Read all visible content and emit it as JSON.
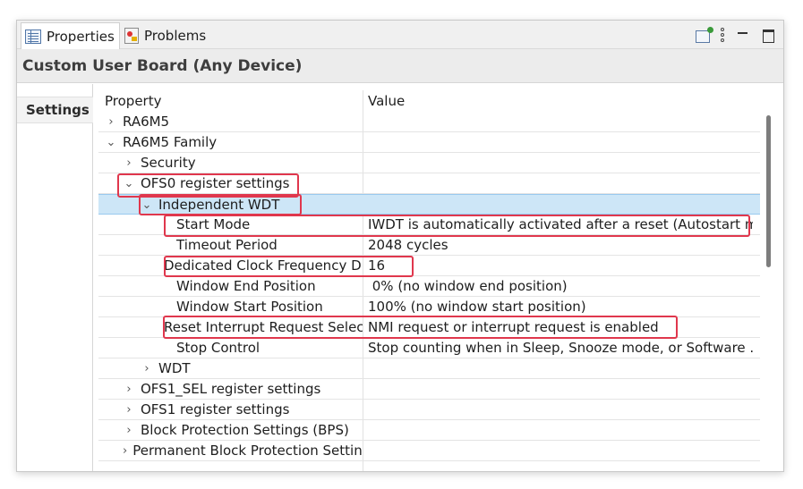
{
  "tabs": {
    "properties_label": "Properties",
    "problems_label": "Problems"
  },
  "toolbar": {
    "icons": [
      "pin-to-selection-icon",
      "view-menu-icon",
      "minimize-icon",
      "maximize-icon"
    ]
  },
  "header": {
    "title": "Custom User Board (Any Device)"
  },
  "side": {
    "settings_label": "Settings"
  },
  "table": {
    "col_property": "Property",
    "col_value": "Value",
    "rows": [
      {
        "label": "RA6M5",
        "value": "",
        "twisty": "›",
        "depth": 0
      },
      {
        "label": "RA6M5 Family",
        "value": "",
        "twisty": "⌄",
        "depth": 0
      },
      {
        "label": "Security",
        "value": "",
        "twisty": "›",
        "depth": 1
      },
      {
        "label": "OFS0 register settings",
        "value": "",
        "twisty": "⌄",
        "depth": 1
      },
      {
        "label": "Independent WDT",
        "value": "",
        "twisty": "⌄",
        "depth": 2
      },
      {
        "label": "Start Mode",
        "value": "IWDT is automatically activated after a reset (Autostart m...",
        "twisty": "",
        "depth": 3
      },
      {
        "label": "Timeout Period",
        "value": "2048 cycles",
        "twisty": "",
        "depth": 3
      },
      {
        "label": "Dedicated Clock Frequency Divisor",
        "value": "16",
        "twisty": "",
        "depth": 3
      },
      {
        "label": "Window End Position",
        "value": " 0% (no window end position)",
        "twisty": "",
        "depth": 3
      },
      {
        "label": "Window Start Position",
        "value": "100% (no window start position)",
        "twisty": "",
        "depth": 3
      },
      {
        "label": "Reset Interrupt Request Select",
        "value": "NMI request or interrupt request is enabled",
        "twisty": "",
        "depth": 3
      },
      {
        "label": "Stop Control",
        "value": "Stop counting when in Sleep, Snooze mode, or Software ...",
        "twisty": "",
        "depth": 3
      },
      {
        "label": "WDT",
        "value": "",
        "twisty": "›",
        "depth": 2
      },
      {
        "label": "OFS1_SEL register settings",
        "value": "",
        "twisty": "›",
        "depth": 1
      },
      {
        "label": "OFS1 register settings",
        "value": "",
        "twisty": "›",
        "depth": 1
      },
      {
        "label": "Block Protection Settings (BPS)",
        "value": "",
        "twisty": "›",
        "depth": 1
      },
      {
        "label": "Permanent Block Protection Settings",
        "value": "",
        "twisty": "›",
        "depth": 1
      }
    ]
  },
  "highlight_color": "#e0374d",
  "selection_color": "#cde6f7"
}
